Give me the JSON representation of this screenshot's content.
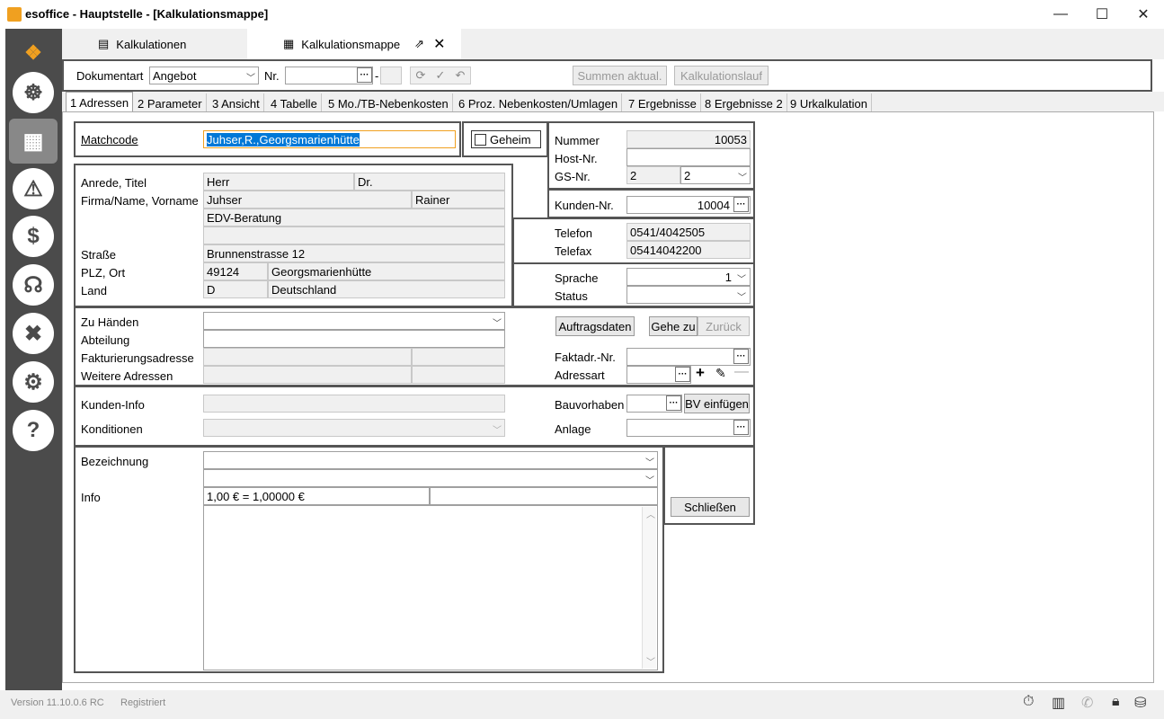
{
  "window": {
    "title": "esoffice - Hauptstelle - [Kalkulationsmappe]"
  },
  "tabs": [
    {
      "label": "Kalkulationen"
    },
    {
      "label": "Kalkulationsmappe"
    }
  ],
  "toolbar": {
    "dokumentart_label": "Dokumentart",
    "dokumentart_value": "Angebot",
    "nr_label": "Nr.",
    "nr_value": "",
    "summen_button": "Summen aktual.",
    "kalkulationslauf_button": "Kalkulationslauf"
  },
  "subtabs": [
    "1 Adressen",
    "2 Parameter",
    "3 Ansicht",
    "4 Tabelle",
    "5 Mo./TB-Nebenkosten",
    "6 Proz. Nebenkosten/Umlagen",
    "7 Ergebnisse",
    "8 Ergebnisse 2",
    "9 Urkalkulation"
  ],
  "matchcode": {
    "label": "Matchcode",
    "value": "Juhser,R.,Georgsmarienhütte",
    "geheim_label": "Geheim"
  },
  "address": {
    "anrede_label": "Anrede, Titel",
    "anrede": "Herr",
    "titel": "Dr.",
    "firma_label": "Firma/Name, Vorname",
    "name": "Juhser",
    "vorname": "Rainer",
    "firma2": "EDV-Beratung",
    "firma3": "",
    "strasse_label": "Straße",
    "strasse": "Brunnenstrasse 12",
    "plz_label": "PLZ, Ort",
    "plz": "49124",
    "ort": "Georgsmarienhütte",
    "land_label": "Land",
    "land_code": "D",
    "land": "Deutschland"
  },
  "numbers": {
    "nummer_label": "Nummer",
    "nummer": "10053",
    "host_label": "Host-Nr.",
    "host": "",
    "gs_label": "GS-Nr.",
    "gs1": "2",
    "gs2": "2",
    "kunden_label": "Kunden-Nr.",
    "kunden": "10004",
    "telefon_label": "Telefon",
    "telefon": "0541/4042505",
    "telefax_label": "Telefax",
    "telefax": "05414042200",
    "sprache_label": "Sprache",
    "sprache": "1",
    "status_label": "Status",
    "status": ""
  },
  "extra": {
    "zuhaenden_label": "Zu Händen",
    "abteilung_label": "Abteilung",
    "faktadr_label": "Fakturierungsadresse",
    "weitere_label": "Weitere Adressen",
    "auftragsdaten_button": "Auftragsdaten",
    "gehezu_button": "Gehe zu",
    "zurueck_button": "Zurück",
    "faktadrnr_label": "Faktadr.-Nr.",
    "adressart_label": "Adressart",
    "kundeninfo_label": "Kunden-Info",
    "konditionen_label": "Konditionen",
    "bauvorhaben_label": "Bauvorhaben",
    "bv_button": "BV einfügen",
    "anlage_label": "Anlage",
    "bezeichnung_label": "Bezeichnung",
    "info_label": "Info",
    "info_value": "1,00 € = 1,00000 €",
    "schliessen_button": "Schließen"
  },
  "status": {
    "version": "Version 11.10.0.6 RC",
    "registered": "Registriert"
  }
}
